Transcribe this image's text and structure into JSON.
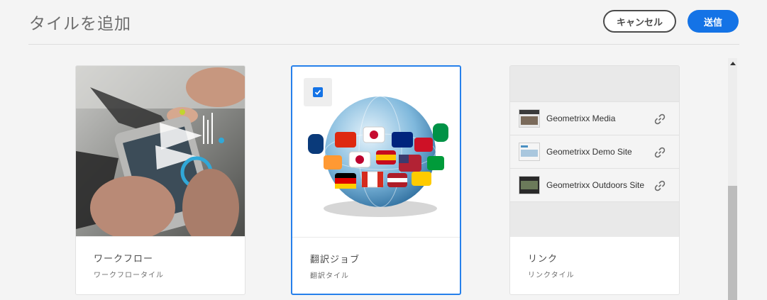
{
  "header": {
    "title": "タイルを追加",
    "cancel_label": "キャンセル",
    "submit_label": "送信"
  },
  "cards": [
    {
      "title": "ワークフロー",
      "subtitle": "ワークフロータイル",
      "selected": false
    },
    {
      "title": "翻訳ジョブ",
      "subtitle": "翻訳タイル",
      "selected": true
    },
    {
      "title": "リンク",
      "subtitle": "リンクタイル",
      "selected": false,
      "links": [
        {
          "label": "Geometrixx Media"
        },
        {
          "label": "Geometrixx Demo Site"
        },
        {
          "label": "Geometrixx Outdoors Site"
        }
      ]
    }
  ],
  "colors": {
    "accent": "#1473e6",
    "selected_border": "#2680eb"
  },
  "icons": [
    "checkbox-checked-icon",
    "link-icon",
    "scroll-up-arrow-icon"
  ]
}
